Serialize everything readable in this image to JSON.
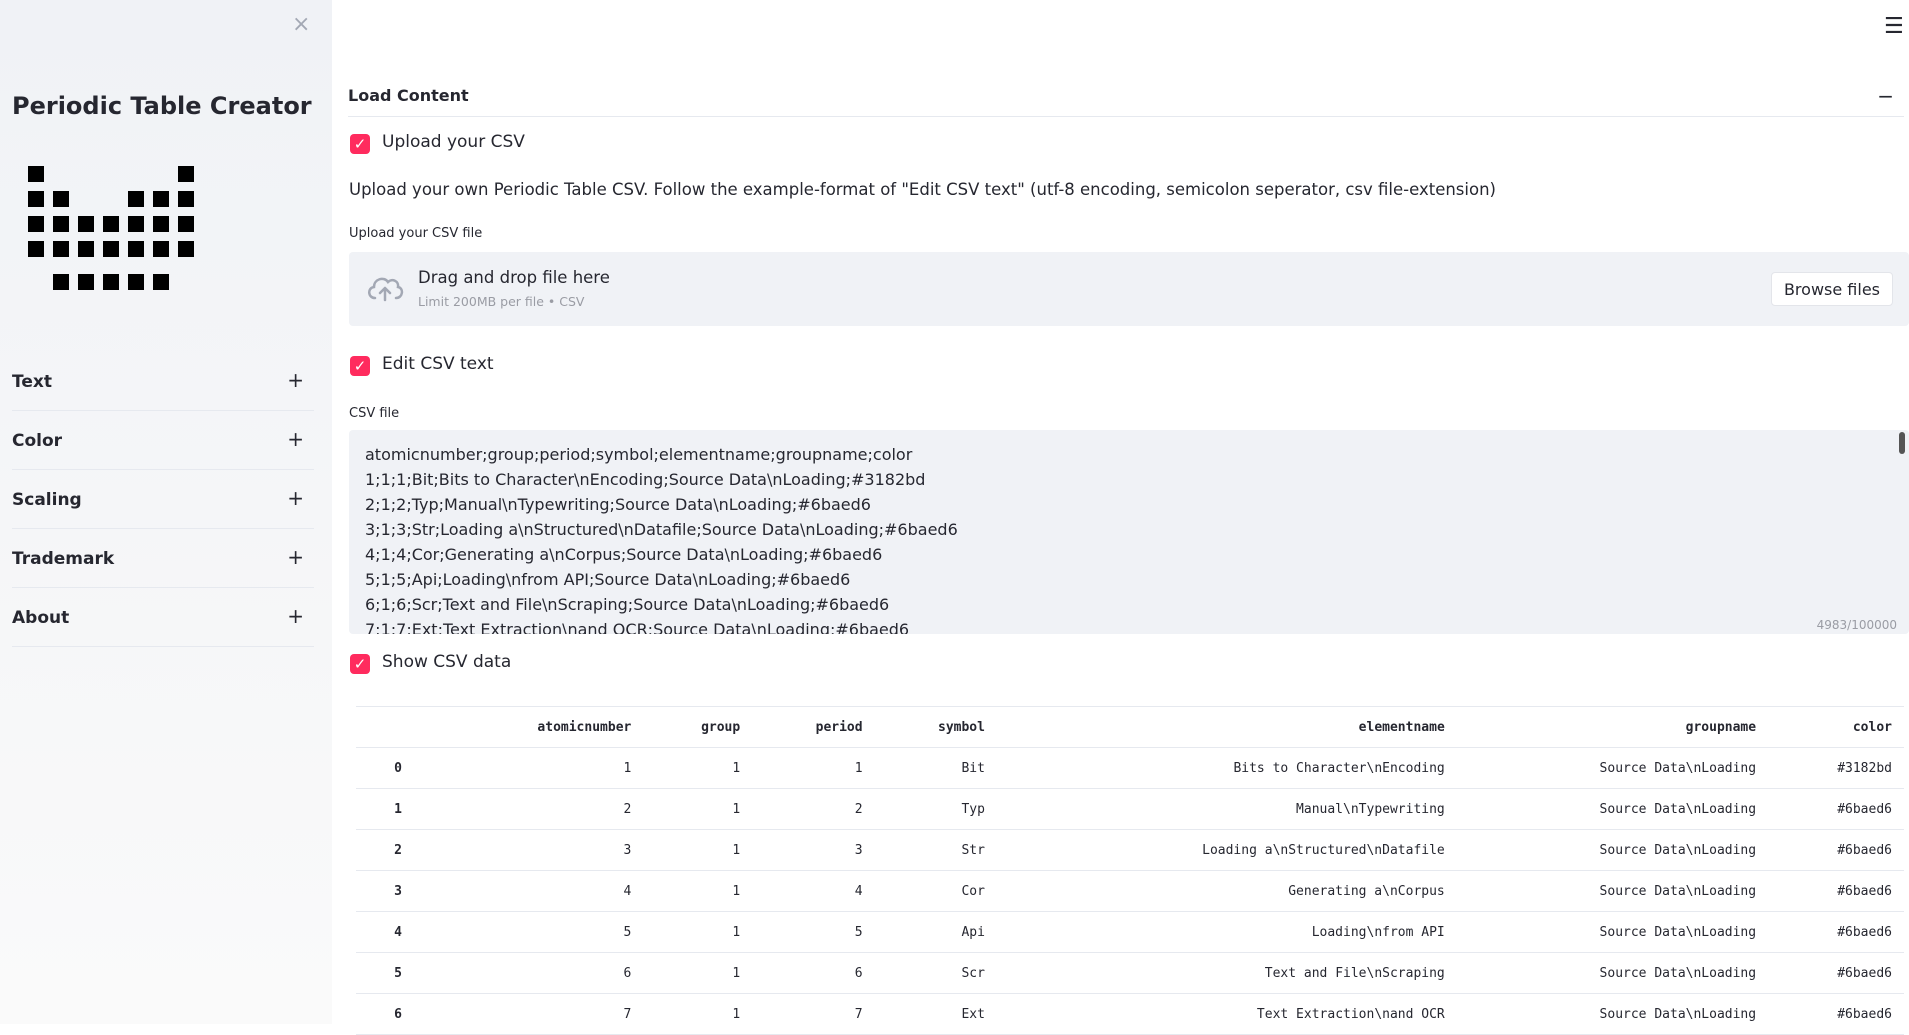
{
  "sidebar": {
    "close_icon": "×",
    "title": "Periodic Table Creator",
    "sections": [
      {
        "label": "Text",
        "icon": "+"
      },
      {
        "label": "Color",
        "icon": "+"
      },
      {
        "label": "Scaling",
        "icon": "+"
      },
      {
        "label": "Trademark",
        "icon": "+"
      },
      {
        "label": "About",
        "icon": "+"
      }
    ]
  },
  "header": {
    "menu_icon": "☰"
  },
  "expander": {
    "title": "Load Content",
    "toggle_icon": "−"
  },
  "upload": {
    "checkbox_label": "Upload your CSV",
    "description": "Upload your own Periodic Table CSV. Follow the example-format of \"Edit CSV text\" (utf-8 encoding, semicolon seperator, csv file-extension)",
    "file_label": "Upload your CSV file",
    "dropzone_main": "Drag and drop file here",
    "dropzone_sub": "Limit 200MB per file • CSV",
    "browse_label": "Browse files"
  },
  "edit": {
    "checkbox_label": "Edit CSV text",
    "textarea_label": "CSV file",
    "lines": [
      "atomicnumber;group;period;symbol;elementname;groupname;color",
      "1;1;1;Bit;Bits to Character\\nEncoding;Source Data\\nLoading;#3182bd",
      "2;1;2;Typ;Manual\\nTypewriting;Source Data\\nLoading;#6baed6",
      "3;1;3;Str;Loading a\\nStructured\\nDatafile;Source Data\\nLoading;#6baed6",
      "4;1;4;Cor;Generating a\\nCorpus;Source Data\\nLoading;#6baed6",
      "5;1;5;Api;Loading\\nfrom API;Source Data\\nLoading;#6baed6",
      "6;1;6;Scr;Text and File\\nScraping;Source Data\\nLoading;#6baed6",
      "7;1;7;Ext;Text Extraction\\nand OCR;Source Data\\nLoading;#6baed6"
    ],
    "counter": "4983/100000"
  },
  "show": {
    "checkbox_label": "Show CSV data"
  },
  "table": {
    "columns": [
      "atomicnumber",
      "group",
      "period",
      "symbol",
      "elementname",
      "groupname",
      "color"
    ],
    "rows": [
      {
        "index": "0",
        "cells": [
          "1",
          "1",
          "1",
          "Bit",
          "Bits to Character\\nEncoding",
          "Source Data\\nLoading",
          "#3182bd"
        ]
      },
      {
        "index": "1",
        "cells": [
          "2",
          "1",
          "2",
          "Typ",
          "Manual\\nTypewriting",
          "Source Data\\nLoading",
          "#6baed6"
        ]
      },
      {
        "index": "2",
        "cells": [
          "3",
          "1",
          "3",
          "Str",
          "Loading a\\nStructured\\nDatafile",
          "Source Data\\nLoading",
          "#6baed6"
        ]
      },
      {
        "index": "3",
        "cells": [
          "4",
          "1",
          "4",
          "Cor",
          "Generating a\\nCorpus",
          "Source Data\\nLoading",
          "#6baed6"
        ]
      },
      {
        "index": "4",
        "cells": [
          "5",
          "1",
          "5",
          "Api",
          "Loading\\nfrom API",
          "Source Data\\nLoading",
          "#6baed6"
        ]
      },
      {
        "index": "5",
        "cells": [
          "6",
          "1",
          "6",
          "Scr",
          "Text and File\\nScraping",
          "Source Data\\nLoading",
          "#6baed6"
        ]
      },
      {
        "index": "6",
        "cells": [
          "7",
          "1",
          "7",
          "Ext",
          "Text Extraction\\nand OCR",
          "Source Data\\nLoading",
          "#6baed6"
        ]
      }
    ]
  },
  "colors": {
    "accent": "#ff2b5e",
    "sidebar_bg": "#f0f2f6",
    "text": "#262730"
  }
}
